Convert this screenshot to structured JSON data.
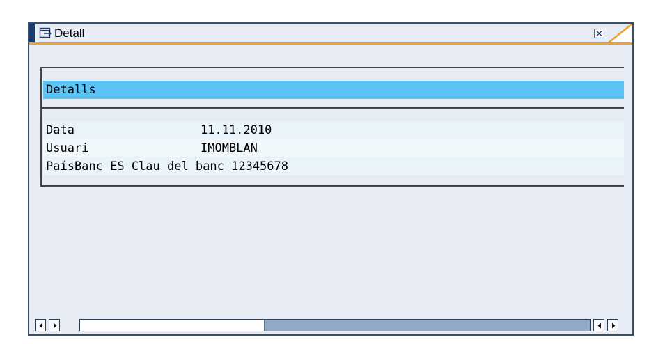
{
  "window": {
    "title": "Detall"
  },
  "list": {
    "header": "Detalls",
    "rows": [
      {
        "label": "Data",
        "value": "11.11.2010"
      },
      {
        "label": "Usuari",
        "value": "IMOMBLAN"
      },
      {
        "label": "PaísBanc ES Clau del banc 12345678",
        "value": ""
      }
    ]
  },
  "scrollbar": {
    "position": 0.36
  },
  "colors": {
    "header_highlight": "#5bc4f5",
    "title_accent": "#f0a030",
    "window_bg": "#e7ebf3"
  },
  "icons": {
    "title": "display-window-icon",
    "close": "close-icon",
    "left": "arrow-left-icon",
    "right": "arrow-right-icon"
  }
}
